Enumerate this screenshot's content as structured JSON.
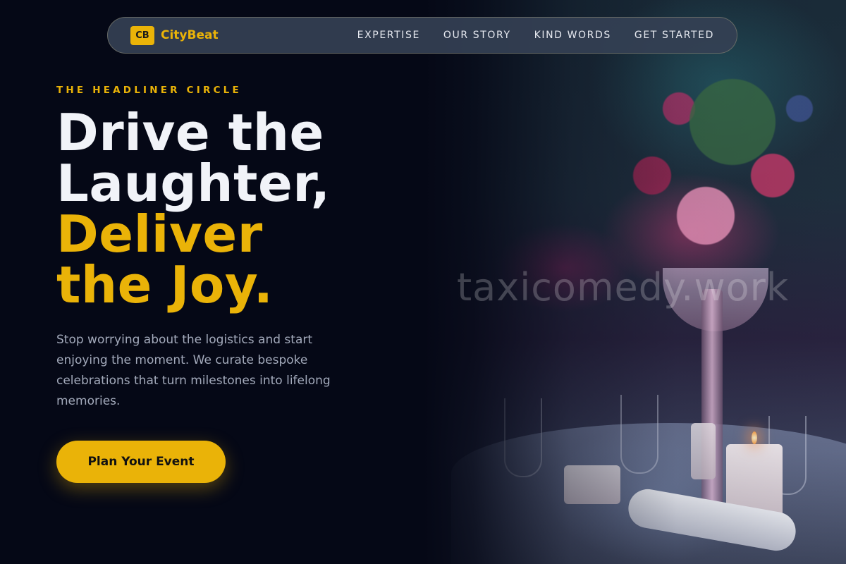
{
  "colors": {
    "accent": "#eab308",
    "background": "#050816",
    "nav_bg": "#344054"
  },
  "nav": {
    "logo_badge": "CB",
    "brand": "CityBeat",
    "links": [
      "EXPERTISE",
      "OUR STORY",
      "KIND WORDS",
      "GET STARTED"
    ]
  },
  "hero": {
    "eyebrow": "THE HEADLINER CIRCLE",
    "headline_white": [
      "Drive the",
      "Laughter,"
    ],
    "headline_gold": [
      "Deliver",
      "the Joy."
    ],
    "subtext": "Stop worrying about the logistics and start enjoying the moment. We curate bespoke celebrations that turn milestones into lifelong memories.",
    "cta_label": "Plan Your Event"
  },
  "watermark": "taxicomedy.work"
}
